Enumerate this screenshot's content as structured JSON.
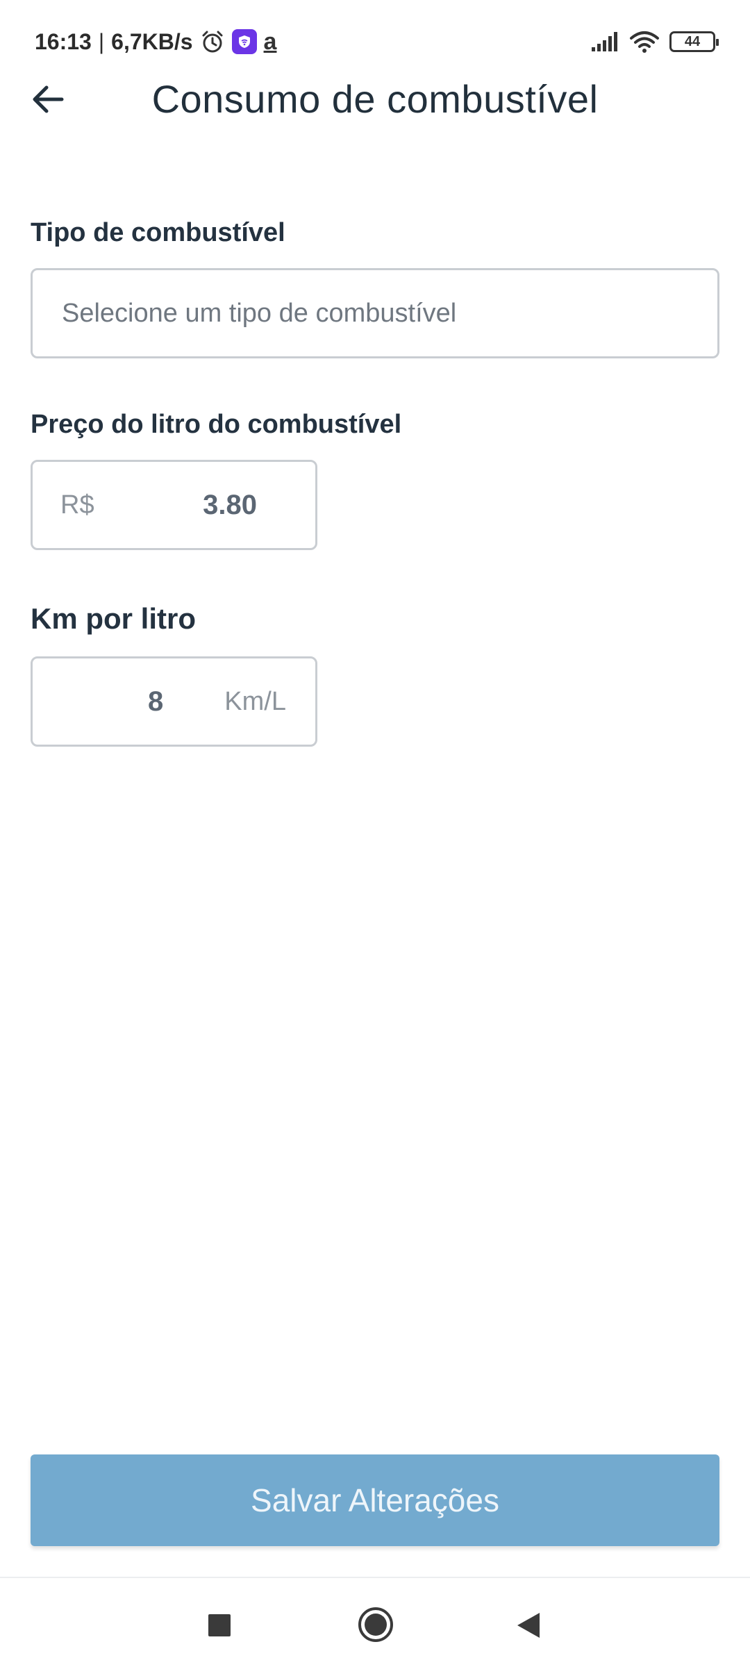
{
  "status_bar": {
    "time": "16:13",
    "separator": "|",
    "speed": "6,7KB/s",
    "battery": "44",
    "icons": [
      "alarm-icon",
      "vpn-icon",
      "amazon-icon",
      "signal-icon",
      "wifi-icon",
      "battery-icon"
    ]
  },
  "header": {
    "title": "Consumo de combustível",
    "back_icon": "arrow-left-icon"
  },
  "form": {
    "fuel_type": {
      "label": "Tipo de combustível",
      "placeholder": "Selecione um tipo de combustível"
    },
    "price": {
      "label": "Preço do litro do combustível",
      "prefix": "R$",
      "value": "3.80"
    },
    "km_per_liter": {
      "label": "Km por litro",
      "value": "8",
      "suffix": "Km/L"
    }
  },
  "actions": {
    "save_label": "Salvar Alterações"
  },
  "colors": {
    "save_button": "#73aacf",
    "title_text": "#22303c",
    "input_border": "#c9cdd2"
  },
  "nav_bar": {
    "icons": [
      "recents-square-icon",
      "home-circle-icon",
      "back-triangle-icon"
    ]
  }
}
